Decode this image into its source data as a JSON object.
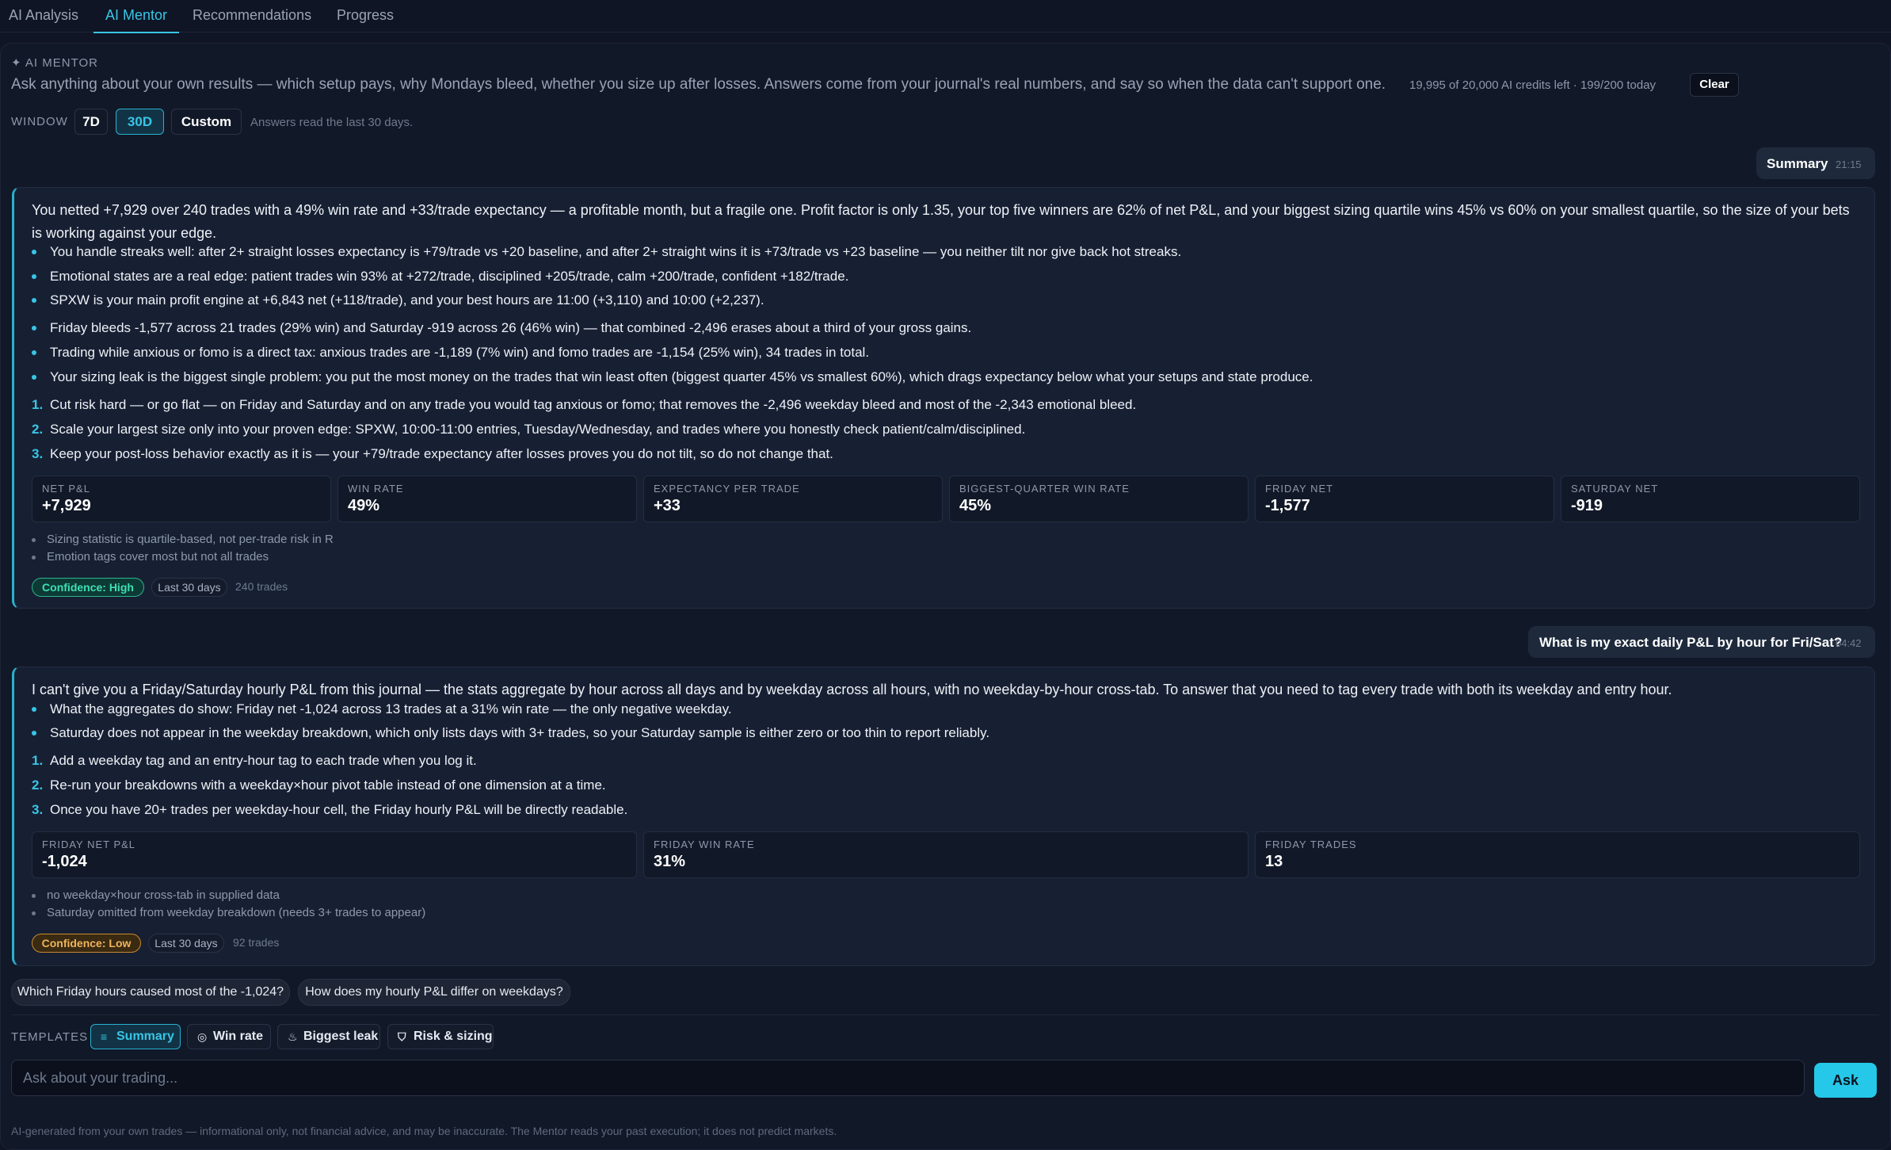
{
  "tabs": [
    {
      "label": "AI Analysis"
    },
    {
      "label": "AI Mentor"
    },
    {
      "label": "Recommendations"
    },
    {
      "label": "Progress"
    }
  ],
  "header": {
    "kicker": "✦ AI MENTOR",
    "description": "Ask anything about your own results — which setup pays, why Mondays bleed, whether you size up after losses. Answers come from your journal's real numbers, and say so when the data can't support one.",
    "credits": "19,995 of 20,000 AI credits left · 199/200 today",
    "clear_label": "Clear"
  },
  "window": {
    "label": "WINDOW",
    "options": [
      "7D",
      "30D",
      "Custom"
    ],
    "selected": "30D",
    "note": "Answers read the last 30 days."
  },
  "conversation": [
    {
      "user": {
        "text": "Summary",
        "time": "21:15"
      },
      "answer": {
        "intro": "You netted +7,929 over 240 trades with a 49% win rate and +33/trade expectancy — a profitable month, but a fragile one. Profit factor is only 1.35, your top five winners are 62% of net P&L, and your biggest sizing quartile wins 45% vs 60% on your smallest quartile, so the size of your bets is working against your edge.",
        "strengths": [
          "You handle streaks well: after 2+ straight losses expectancy is +79/trade vs +20 baseline, and after 2+ straight wins it is +73/trade vs +23 baseline — you neither tilt nor give back hot streaks.",
          "Emotional states are a real edge: patient trades win 93% at +272/trade, disciplined +205/trade, calm +200/trade, confident +182/trade.",
          "SPXW is your main profit engine at +6,843 net (+118/trade), and your best hours are 11:00 (+3,110) and 10:00 (+2,237)."
        ],
        "weaknesses": [
          "Friday bleeds -1,577 across 21 trades (29% win) and Saturday -919 across 26 (46% win) — that combined -2,496 erases about a third of your gross gains.",
          "Trading while anxious or fomo is a direct tax: anxious trades are -1,189 (7% win) and fomo trades are -1,154 (25% win), 34 trades in total.",
          "Your sizing leak is the biggest single problem: you put the most money on the trades that win least often (biggest quarter 45% vs smallest 60%), which drags expectancy below what your setups and state produce."
        ],
        "actions": [
          "Cut risk hard — or go flat — on Friday and Saturday and on any trade you would tag anxious or fomo; that removes the -2,496 weekday bleed and most of the -2,343 emotional bleed.",
          "Scale your largest size only into your proven edge: SPXW, 10:00-11:00 entries, Tuesday/Wednesday, and trades where you honestly check patient/calm/disciplined.",
          "Keep your post-loss behavior exactly as it is — your +79/trade expectancy after losses proves you do not tilt, so do not change that."
        ],
        "stats": [
          {
            "label": "NET P&L",
            "value": "+7,929"
          },
          {
            "label": "WIN RATE",
            "value": "49%"
          },
          {
            "label": "EXPECTANCY PER TRADE",
            "value": "+33"
          },
          {
            "label": "BIGGEST-QUARTER WIN RATE",
            "value": "45%"
          },
          {
            "label": "FRIDAY NET",
            "value": "-1,577"
          },
          {
            "label": "SATURDAY NET",
            "value": "-919"
          }
        ],
        "caveats": [
          "Sizing statistic is quartile-based, not per-trade risk in R",
          "Emotion tags cover most but not all trades"
        ],
        "confidence": "Confidence: High",
        "period": "Last 30 days",
        "trades": "240 trades"
      }
    },
    {
      "user": {
        "text": "What is my exact daily P&L by hour for Fri/Sat?",
        "time": "04:42"
      },
      "answer": {
        "intro": "I can't give you a Friday/Saturday hourly P&L from this journal — the stats aggregate by hour across all days and by weekday across all hours, with no weekday-by-hour cross-tab. To answer that you need to tag every trade with both its weekday and entry hour.",
        "bullets": [
          "What the aggregates do show: Friday net -1,024 across 13 trades at a 31% win rate — the only negative weekday.",
          "Saturday does not appear in the weekday breakdown, which only lists days with 3+ trades, so your Saturday sample is either zero or too thin to report reliably."
        ],
        "actions": [
          "Add a weekday tag and an entry-hour tag to each trade when you log it.",
          "Re-run your breakdowns with a weekday×hour pivot table instead of one dimension at a time.",
          "Once you have 20+ trades per weekday-hour cell, the Friday hourly P&L will be directly readable."
        ],
        "stats": [
          {
            "label": "FRIDAY NET P&L",
            "value": "-1,024"
          },
          {
            "label": "FRIDAY WIN RATE",
            "value": "31%"
          },
          {
            "label": "FRIDAY TRADES",
            "value": "13"
          }
        ],
        "caveats": [
          "no weekday×hour cross-tab in supplied data",
          "Saturday omitted from weekday breakdown (needs 3+ trades to appear)"
        ],
        "confidence": "Confidence: Low",
        "period": "Last 30 days",
        "trades": "92 trades"
      }
    }
  ],
  "suggestions": [
    "Which Friday hours caused most of the -1,024?",
    "How does my hourly P&L differ on weekdays?"
  ],
  "templates": {
    "label": "TEMPLATES",
    "items": [
      {
        "icon": "≡",
        "icon_name": "list-icon",
        "label": "Summary"
      },
      {
        "icon": "◎",
        "icon_name": "target-icon",
        "label": "Win rate"
      },
      {
        "icon": "♨",
        "icon_name": "flame-icon",
        "label": "Biggest leak"
      },
      {
        "icon": "⛉",
        "icon_name": "shield-icon",
        "label": "Risk & sizing"
      }
    ]
  },
  "ask": {
    "placeholder": "Ask about your trading...",
    "button": "Ask"
  },
  "footer": "AI-generated from your own trades — informational only, not financial advice, and may be inaccurate. The Mentor reads your past execution; it does not predict markets.",
  "colors": {
    "accent": "#38c6e6",
    "background": "#0f1524",
    "high": "#3ee0b0",
    "low": "#f0b45a"
  }
}
